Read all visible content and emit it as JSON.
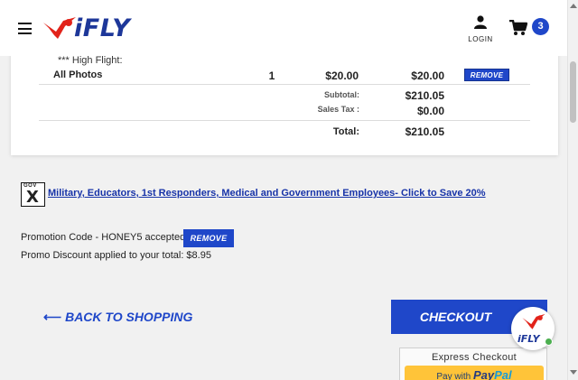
{
  "header": {
    "logo_text": "iFLY",
    "login_label": "LOGIN",
    "cart_count": "3"
  },
  "order": {
    "note": "*** High Flight:",
    "item": {
      "name": "All Photos",
      "qty": "1",
      "price": "$20.00",
      "total": "$20.00",
      "remove_label": "REMOVE"
    },
    "subtotal_label": "Subtotal:",
    "subtotal_value": "$210.05",
    "tax_label": "Sales Tax :",
    "tax_value": "$0.00",
    "total_label": "Total:",
    "total_value": "$210.05"
  },
  "military": {
    "badge_top": "GOV",
    "badge_letter": "X",
    "link_text": "Military, Educators, 1st Responders, Medical and Government Employees- Click to Save 20%"
  },
  "promo": {
    "accepted_text": "Promotion Code - HONEY5 accepted.",
    "remove_label": "REMOVE",
    "discount_text": "Promo Discount applied to your total: $8.95"
  },
  "actions": {
    "back_label": "BACK TO SHOPPING",
    "checkout_label": "CHECKOUT",
    "express_label": "Express Checkout",
    "paypal_prefix": "Pay with",
    "paypal_brand_1": "Pay",
    "paypal_brand_2": "Pal"
  },
  "chat": {
    "logo_text": "iFLY"
  },
  "colors": {
    "brand_blue": "#1f47c9",
    "logo_red": "#e2231a",
    "link_blue": "#1733a8",
    "paypal_yellow": "#ffc439"
  }
}
